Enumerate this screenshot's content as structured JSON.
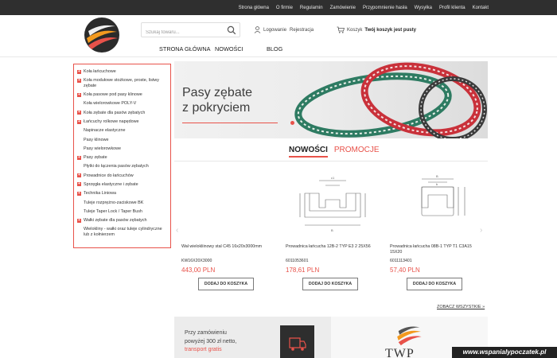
{
  "top_nav": [
    "Strona główna",
    "O firmie",
    "Regulamin",
    "Zamówienie",
    "Przypomnienie hasła",
    "Wysyłka",
    "Profil klienta",
    "Kontakt"
  ],
  "search": {
    "placeholder": "Szukaj towaru..."
  },
  "account": {
    "login": "Logowanie",
    "register": "Rejestracja"
  },
  "cart": {
    "label": "Koszyk",
    "status": "Twój koszyk jest pusty"
  },
  "main_nav": [
    "STRONA GŁÓWNA",
    "NOWOŚCI",
    "BLOG"
  ],
  "sidebar": [
    {
      "label": "Koła łańcuchowe",
      "expand": true
    },
    {
      "label": "Koła modułowe stożkowe, proste, listwy zębate",
      "expand": true
    },
    {
      "label": "Koła pasowe pod pasy klinowe",
      "expand": true
    },
    {
      "label": "Koła wielorowkowe POLY-V",
      "expand": false
    },
    {
      "label": "Koła zębate dla pasów zębatych",
      "expand": true
    },
    {
      "label": "Łańcuchy rolkowe napędowe",
      "expand": true
    },
    {
      "label": "Napinacze elastyczne",
      "expand": false
    },
    {
      "label": "Pasy klinowe",
      "expand": false
    },
    {
      "label": "Pasy wielorowkowe",
      "expand": false
    },
    {
      "label": "Pasy zębate",
      "expand": true
    },
    {
      "label": "Płytki do łączenia pasów zębatych",
      "expand": false
    },
    {
      "label": "Prowadnice do łańcuchów",
      "expand": true
    },
    {
      "label": "Sprzęgła elastyczne i zębate",
      "expand": true
    },
    {
      "label": "Technika Liniowa",
      "expand": true
    },
    {
      "label": "Tuleje rozprężno-zaciskowe BK",
      "expand": false
    },
    {
      "label": "Tuleje Taper Lock / Taper Bush",
      "expand": false
    },
    {
      "label": "Wałki zębate dla pasów zębatych",
      "expand": true
    },
    {
      "label": "Wielokliny - wałki oraz tuleje cylindryczne lub z kołnierzem",
      "expand": false
    }
  ],
  "banner": {
    "line1": "Pasy zębate",
    "line2": "z pokryciem"
  },
  "tabs": {
    "active": "NOWOŚCI",
    "inactive": "PROMOCJE"
  },
  "products": [
    {
      "name": "Wał wielokliinowy stal C45 16x20x3000mm",
      "code": "KW16X20X3000",
      "price": "443,00 PLN",
      "button": "DODAJ DO KOSZYKA"
    },
    {
      "name": "Prowadnica łańcucha 12B-2 TYP E3 2 25X56",
      "code": "6011053601",
      "price": "178,61 PLN",
      "button": "DODAJ DO KOSZYKA"
    },
    {
      "name": "Prowadnica łańcucha 08B-1 TYP T1 C3A15 15X20",
      "code": "6011113401",
      "price": "57,40 PLN",
      "button": "DODAJ DO KOSZYKA"
    }
  ],
  "see_all": "ZOBACZ WSZYSTKIE »",
  "promo": {
    "line1": "Przy zamówieniu",
    "line2": "powyżej 300 zł netto,",
    "line3": "transport gratis"
  },
  "brand": "TWP",
  "watermark": "www.wspanialypoczatek.pl",
  "colors": {
    "accent": "#e8524a",
    "topbar": "#2f2f2f"
  }
}
